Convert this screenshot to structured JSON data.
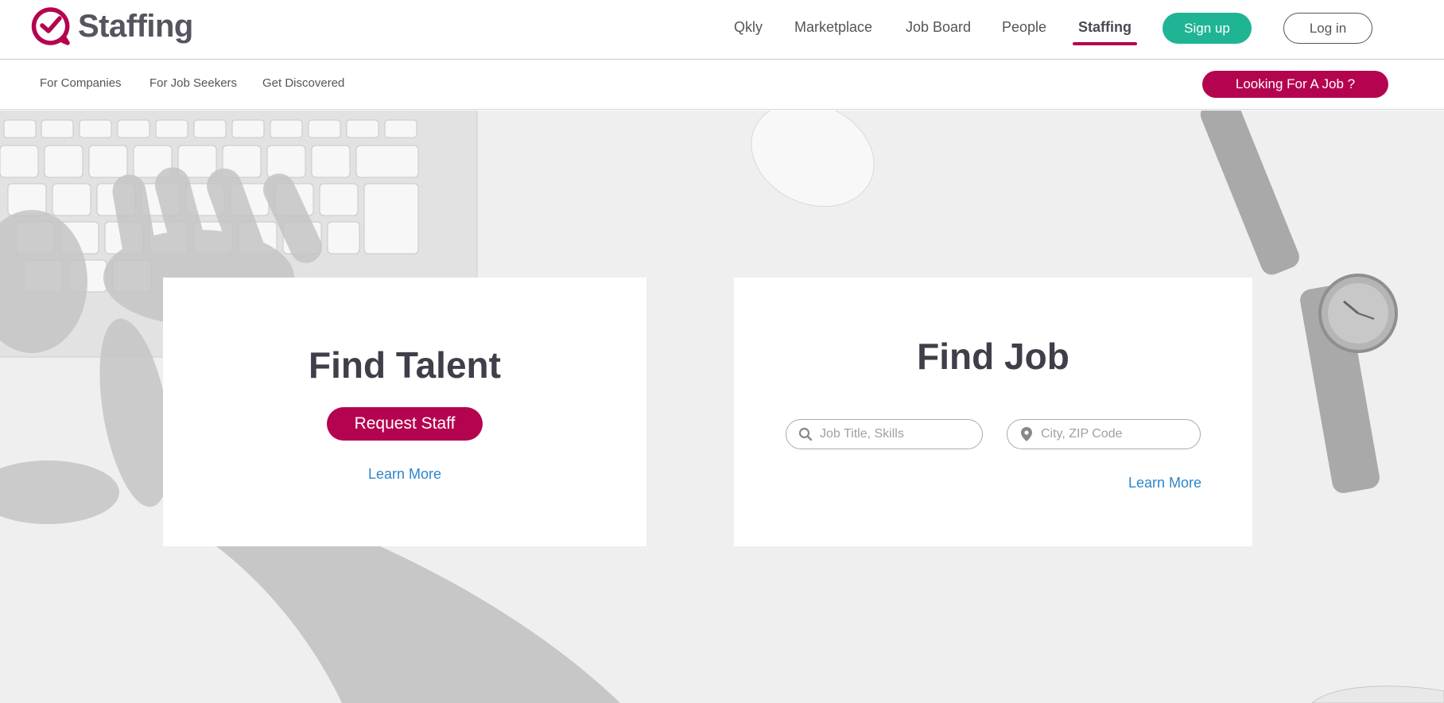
{
  "brand": {
    "name": "Staffing",
    "accent": "#b5044f",
    "green": "#1fb594"
  },
  "header": {
    "nav": [
      "Qkly",
      "Marketplace",
      "Job Board",
      "People",
      "Staffing"
    ],
    "active_nav": "Staffing",
    "signup_label": "Sign up",
    "login_label": "Log in"
  },
  "subnav": {
    "items": [
      "For Companies",
      "For Job Seekers",
      "Get Discovered"
    ],
    "cta_label": "Looking For A Job ?"
  },
  "talent_card": {
    "title": "Find Talent",
    "button_label": "Request Staff",
    "link_label": "Learn More"
  },
  "job_card": {
    "title": "Find Job",
    "job_placeholder": "Job Title, Skills",
    "location_placeholder": "City, ZIP Code",
    "link_label": "Learn More",
    "search_icon": "search-icon",
    "location_icon": "map-pin-icon"
  }
}
